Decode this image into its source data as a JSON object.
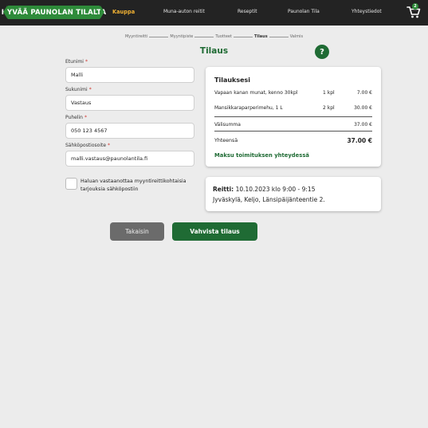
{
  "header": {
    "logo_text": "HYVÄÄ PAUNOLAN TILALTA",
    "nav": [
      {
        "label": "Kauppa",
        "active": true
      },
      {
        "label": "Muna-auton reitit",
        "active": false
      },
      {
        "label": "Reseptit",
        "active": false
      },
      {
        "label": "Paunolan Tila",
        "active": false
      },
      {
        "label": "Yhteystiedot",
        "active": false
      }
    ],
    "cart_icon": "shopping-cart-icon",
    "cart_count": "2"
  },
  "breadcrumb": {
    "steps": [
      "Myyntireitti",
      "Myyntipiste",
      "Tuotteet",
      "Tilaus",
      "Valmis"
    ],
    "current_index": 3
  },
  "page": {
    "title": "Tilaus",
    "help_icon": "question-mark-icon",
    "help_label": "?"
  },
  "form": {
    "fields": [
      {
        "label": "Etunimi",
        "required": "*",
        "value": "Malli"
      },
      {
        "label": "Sukunimi",
        "required": "*",
        "value": "Vastaus"
      },
      {
        "label": "Puhelin",
        "required": "*",
        "value": "050 123 4567"
      },
      {
        "label": "Sähköpostiosoite",
        "required": "*",
        "value": "malli.vastaus@paunolantila.fi"
      }
    ],
    "consent_label": "Haluan vastaanottaa myyntireittikohtaisia tarjouksia sähköpostiin"
  },
  "order": {
    "title": "Tilauksesi",
    "items": [
      {
        "name": "Vapaan kanan munat, kenno 30kpl",
        "qty": "1 kpl",
        "price": "7.00 €"
      },
      {
        "name": "Mansikkaraparperimehu, 1 L",
        "qty": "2 kpl",
        "price": "30.00 €"
      }
    ],
    "subtotal_label": "Välisumma",
    "subtotal": "37.00 €",
    "total_label": "Yhteensä",
    "total": "37.00 €",
    "payment_note": "Maksu toimituksen yhteydessä"
  },
  "route": {
    "label": "Reitti:",
    "datetime": "10.10.2023 klo 9:00 - 9:15",
    "location": "Jyväskylä, Keljo, Länsipäijänteentie 2."
  },
  "buttons": {
    "back": "Takaisin",
    "confirm": "Vahvista tilaus"
  },
  "colors": {
    "brand_green": "#1f6b34",
    "logo_green": "#2e8b3a",
    "nav_active": "#f2b233",
    "topbar": "#232323",
    "background": "#ececec"
  }
}
